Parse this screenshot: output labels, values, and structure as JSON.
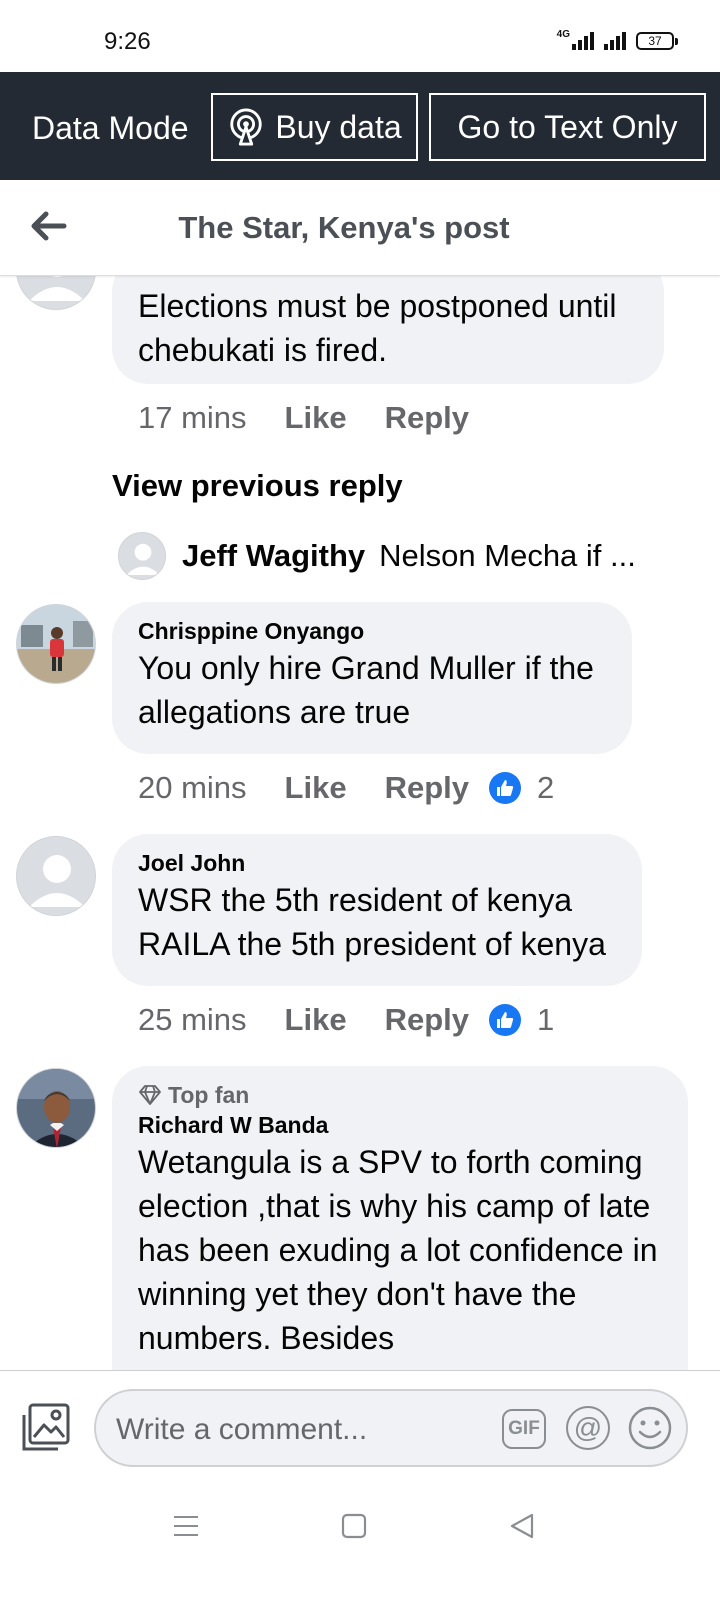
{
  "status_bar": {
    "time": "9:26",
    "network": "4G",
    "battery": "37"
  },
  "data_mode": {
    "label": "Data Mode",
    "buy_data": "Buy data",
    "text_only": "Go to Text Only"
  },
  "header": {
    "title": "The Star, Kenya's post"
  },
  "comments": [
    {
      "text": "Elections must be postponed until chebukati is fired.",
      "time": "17 mins",
      "like": "Like",
      "reply": "Reply"
    },
    {
      "name": "Chrisppine Onyango",
      "text": "You only hire Grand Muller if the allegations are true",
      "time": "20 mins",
      "like": "Like",
      "reply": "Reply",
      "likes": "2"
    },
    {
      "name": "Joel John",
      "text": "WSR the 5th resident of kenya RAILA the 5th president of kenya",
      "time": "25 mins",
      "like": "Like",
      "reply": "Reply",
      "likes": "1"
    },
    {
      "badge": "Top fan",
      "name": "Richard W Banda",
      "text": "Wetangula is a SPV to forth coming election ,that is why his camp of late has been exuding  a lot confidence in winning yet they don't have the numbers. Besides"
    }
  ],
  "view_previous": "View previous reply",
  "reply_preview": {
    "name": "Jeff Wagithy",
    "text": "Nelson Mecha if ..."
  },
  "composer": {
    "placeholder": "Write a comment...",
    "gif": "GIF",
    "mention": "@"
  },
  "colors": {
    "data_bar": "#242a33",
    "bubble": "#f0f2f5",
    "like_blue": "#1877f2",
    "meta_gray": "#65676b"
  }
}
